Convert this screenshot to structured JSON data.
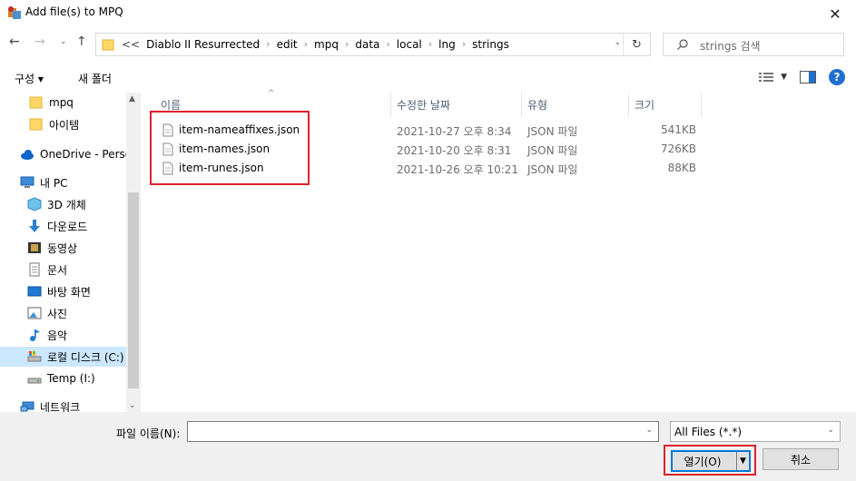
{
  "window": {
    "title": "Add file(s) to MPQ"
  },
  "address": {
    "overflow": "<<",
    "crumbs": [
      "Diablo II Resurrected",
      "edit",
      "mpq",
      "data",
      "local",
      "lng",
      "strings"
    ]
  },
  "search": {
    "placeholder": "strings 검색"
  },
  "toolbar": {
    "organize": "구성 ▾",
    "new_folder": "새 폴더"
  },
  "nav": [
    {
      "label": "mpq",
      "icon": "folder-icon"
    },
    {
      "label": "아이템",
      "icon": "folder-icon"
    },
    {
      "label": "OneDrive - Personal",
      "icon": "cloud-icon"
    },
    {
      "label": "내 PC",
      "icon": "pc-icon"
    },
    {
      "label": "3D 개체",
      "icon": "cube-icon"
    },
    {
      "label": "다운로드",
      "icon": "download-icon"
    },
    {
      "label": "동영상",
      "icon": "video-icon"
    },
    {
      "label": "문서",
      "icon": "document-icon"
    },
    {
      "label": "바탕 화면",
      "icon": "desktop-icon"
    },
    {
      "label": "사진",
      "icon": "picture-icon"
    },
    {
      "label": "음악",
      "icon": "music-icon"
    },
    {
      "label": "로컬 디스크 (C:)",
      "icon": "drive-icon"
    },
    {
      "label": "Temp (I:)",
      "icon": "drive-icon"
    },
    {
      "label": "네트워크",
      "icon": "network-icon"
    }
  ],
  "columns": {
    "name": "이름",
    "date": "수정한 날짜",
    "type": "유형",
    "size": "크기"
  },
  "files": [
    {
      "name": "item-nameaffixes.json",
      "date": "2021-10-27 오후 8:34",
      "type": "JSON 파일",
      "size": "541KB"
    },
    {
      "name": "item-names.json",
      "date": "2021-10-20 오후 8:31",
      "type": "JSON 파일",
      "size": "726KB"
    },
    {
      "name": "item-runes.json",
      "date": "2021-10-26 오후 10:21",
      "type": "JSON 파일",
      "size": "88KB"
    }
  ],
  "bottom": {
    "filename_label": "파일 이름(N):",
    "filename_value": "",
    "filter": "All Files (*.*)",
    "open": "열기(O)",
    "cancel": "취소"
  },
  "colors": {
    "accent": "#0078d7",
    "highlight": "#e0202a",
    "selection": "#cce8ff"
  }
}
